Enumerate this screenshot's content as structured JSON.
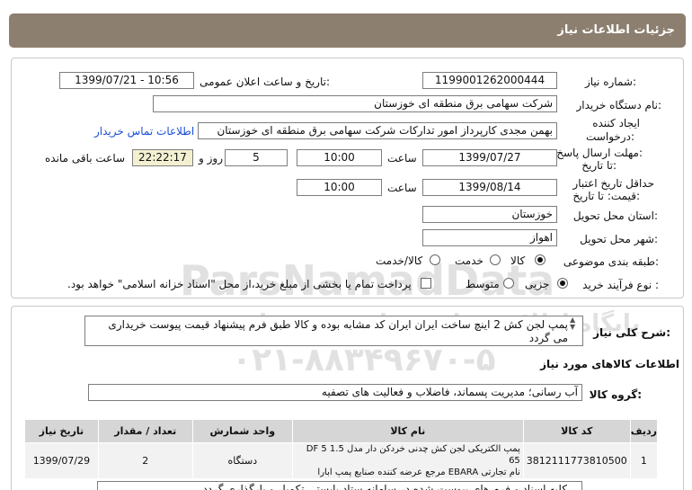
{
  "header": {
    "title": "جزئیات اطلاعات نیاز"
  },
  "form": {
    "need_number_label": "شماره نیاز:",
    "need_number": "1199001262000444",
    "announce_label": "تاریخ و ساعت اعلان عمومی:",
    "announce_value": "1399/07/21 - 10:56",
    "buyer_label": "نام دستگاه خریدار:",
    "buyer_value": "شرکت سهامی برق منطقه ای خوزستان",
    "creator_label_1": "ایجاد کننده",
    "creator_label_2": "درخواست:",
    "creator_value": "بهمن مجدی کارپرداز امور تدارکات شرکت سهامی برق منطقه ای خوزستان",
    "contact_link": "اطلاعات تماس خریدار",
    "deadline_label_1": "مهلت ارسال پاسخ:",
    "deadline_label_2": "تا تاریخ:",
    "deadline_date": "1399/07/27",
    "time_label": "ساعت",
    "deadline_time": "10:00",
    "days_value": "5",
    "days_label": "روز و",
    "remaining_time": "22:22:17",
    "remaining_label": "ساعت باقی مانده",
    "validity_label_1": "حداقل تاریخ اعتبار",
    "validity_label_2": "قیمت: تا تاریخ:",
    "validity_date": "1399/08/14",
    "validity_time": "10:00",
    "province_label": "استان محل تحویل:",
    "province_value": "خوزستان",
    "city_label": "شهر محل تحویل:",
    "city_value": "اهواز",
    "category_label": "طبقه بندی موضوعی:",
    "category_options": [
      "کالا",
      "خدمت",
      "کالا/خدمت"
    ],
    "category_selected": "کالا",
    "process_label": "نوع فرآیند خرید :",
    "process_options": [
      "جزیی",
      "متوسط"
    ],
    "process_selected": "جزیی",
    "payment_note": "پرداخت تمام یا بخشی از مبلغ خرید،از محل \"اسناد خزانه اسلامی\" خواهد بود."
  },
  "watermark": {
    "brand": "ParsNamadData",
    "line1": "پایگاه اطلاع رسانی مناقصه و مزایده",
    "phone": "۰۲۱-۸۸۳۴۹۶۷۰-۵"
  },
  "summary": {
    "label": "شرح کلی نیاز:",
    "text": "پمپ لجن کش 2 اینچ ساخت ایران  ایران کد مشابه بوده و کالا طبق فرم پیشنهاد قیمت پیوست خریداری می گردد"
  },
  "goods": {
    "section_title": "اطلاعات کالاهای مورد نیاز",
    "group_label": "گروه کالا:",
    "group_value": "آب رسانی؛ مدیریت پسماند، فاضلاب و فعالیت های تصفیه",
    "columns": [
      "ردیف",
      "کد کالا",
      "نام کالا",
      "واحد شمارش",
      "تعداد / مقدار",
      "تاریخ نیاز"
    ],
    "rows": [
      {
        "row": "1",
        "code": "3812111773810500",
        "name_1": "پمپ الکتریکی لجن کش چدنی خردکن دار مدل DF 5 1.5 65",
        "name_2": "نام تجارتی EBARA مرجع عرضه کننده صنایع پمپ ابارا",
        "unit": "دستگاه",
        "qty": "2",
        "date": "1399/07/29"
      }
    ],
    "footer_partial": "کلیه اسناد و فرم های پیوست شده در سامانه ستاد بایستی تکمیل و بارگذاری گردد"
  }
}
